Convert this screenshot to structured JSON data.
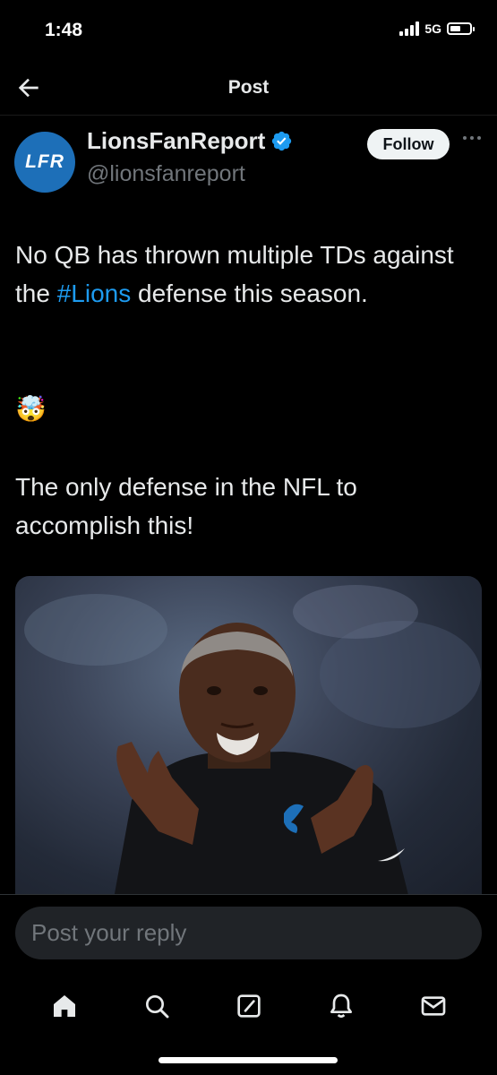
{
  "status": {
    "time": "1:48",
    "network": "5G"
  },
  "header": {
    "title": "Post"
  },
  "author": {
    "name": "LionsFanReport",
    "handle": "@lionsfanreport",
    "avatar_text": "LFR",
    "follow_label": "Follow"
  },
  "post": {
    "line1_before": "No QB has thrown multiple TDs against the ",
    "hashtag": "#Lions",
    "line1_after": " defense this season.",
    "emoji": "🤯",
    "line2": "The only defense in the NFL to accomplish this!"
  },
  "reply": {
    "placeholder": "Post your reply"
  },
  "tabs": [
    "home-icon",
    "search-icon",
    "compose-icon",
    "notifications-icon",
    "messages-icon"
  ],
  "colors": {
    "accent": "#1d9bf0",
    "background": "#000000",
    "text": "#e7e9ea",
    "secondary": "#71767b",
    "avatar": "#1d6fb8"
  }
}
